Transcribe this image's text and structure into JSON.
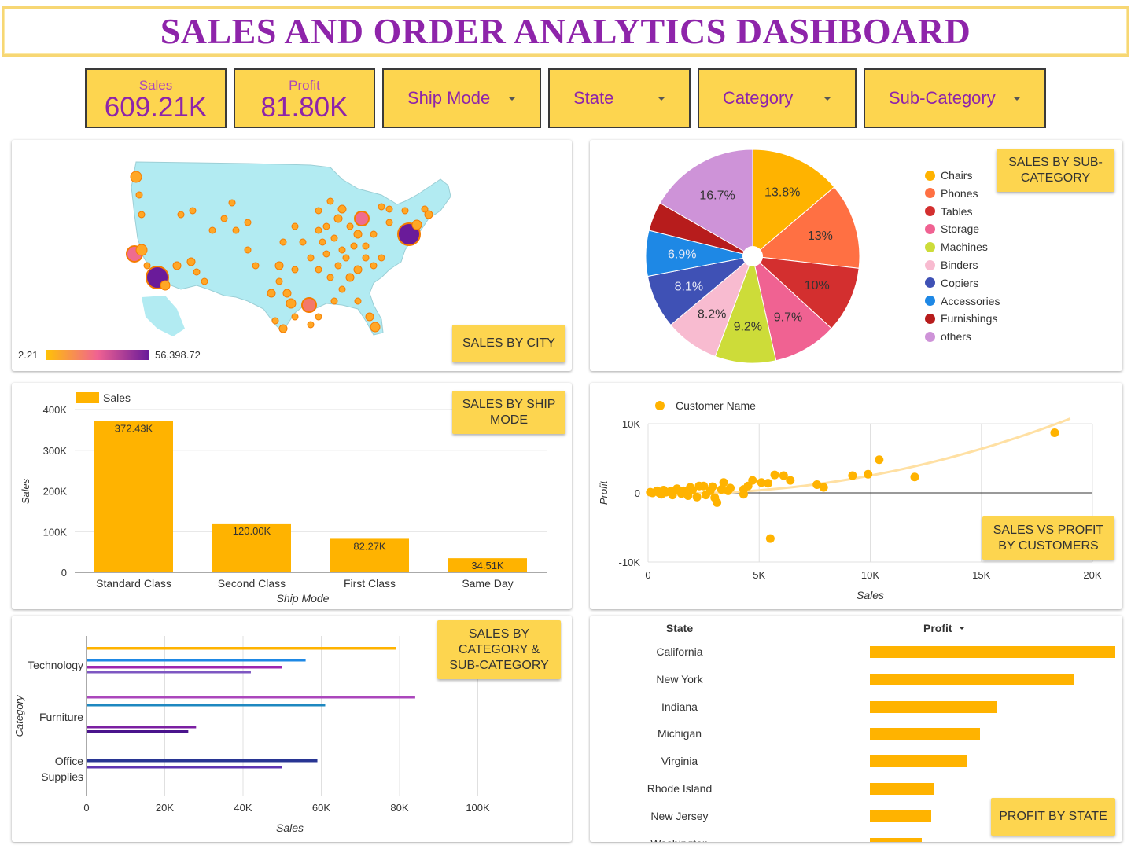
{
  "title": "SALES AND ORDER ANALYTICS DASHBOARD",
  "kpis": {
    "sales": {
      "label": "Sales",
      "value": "609.21K"
    },
    "profit": {
      "label": "Profit",
      "value": "81.80K"
    }
  },
  "filters": {
    "ship_mode": "Ship Mode",
    "state": "State",
    "category": "Category",
    "sub_category": "Sub-Category"
  },
  "colors": {
    "accent": "#fdd54f",
    "title": "#8e24aa",
    "bar": "#ffb300"
  },
  "map_panel": {
    "tag": "SALES BY CITY",
    "scale_min": "2.21",
    "scale_max": "56,398.72"
  },
  "pie_panel": {
    "tag": "SALES BY SUB-CATEGORY",
    "chart_data": {
      "type": "pie",
      "slices": [
        {
          "name": "Chairs",
          "label": "13.8%",
          "value": 13.8,
          "color": "#ffb300"
        },
        {
          "name": "Phones",
          "label": "13%",
          "value": 13.0,
          "color": "#ff7043"
        },
        {
          "name": "Tables",
          "label": "10%",
          "value": 10.0,
          "color": "#d32f2f"
        },
        {
          "name": "Storage",
          "label": "9.7%",
          "value": 9.7,
          "color": "#f06292"
        },
        {
          "name": "Machines",
          "label": "9.2%",
          "value": 9.2,
          "color": "#cddc39"
        },
        {
          "name": "Binders",
          "label": "8.2%",
          "value": 8.2,
          "color": "#f8bbd0"
        },
        {
          "name": "Copiers",
          "label": "8.1%",
          "value": 8.1,
          "color": "#3f51b5"
        },
        {
          "name": "Accessories",
          "label": "6.9%",
          "value": 6.9,
          "color": "#1e88e5"
        },
        {
          "name": "Furnishings",
          "label": "",
          "value": 4.4,
          "color": "#b71c1c"
        },
        {
          "name": "others",
          "label": "16.7%",
          "value": 16.7,
          "color": "#ce93d8"
        }
      ]
    }
  },
  "ship_panel": {
    "tag": "SALES BY SHIP MODE",
    "chart_data": {
      "type": "bar",
      "legend": "Sales",
      "xlabel": "Ship Mode",
      "ylabel": "Sales",
      "categories": [
        "Standard Class",
        "Second Class",
        "First Class",
        "Same Day"
      ],
      "values": [
        372430,
        120000,
        82270,
        34510
      ],
      "value_labels": [
        "372.43K",
        "120.00K",
        "82.27K",
        "34.51K"
      ],
      "yticks": [
        "0",
        "100K",
        "200K",
        "300K",
        "400K"
      ],
      "ylim": [
        0,
        400000
      ]
    }
  },
  "scatter_panel": {
    "tag": "SALES VS PROFIT BY CUSTOMERS",
    "chart_data": {
      "type": "scatter",
      "legend": "Customer Name",
      "xlabel": "Sales",
      "ylabel": "Profit",
      "xticks": [
        "0",
        "5K",
        "10K",
        "15K",
        "20K"
      ],
      "yticks": [
        "-10K",
        "0",
        "10K"
      ],
      "xlim": [
        0,
        20000
      ],
      "ylim": [
        -10000,
        10000
      ],
      "trendline": true,
      "points": [
        [
          18300,
          8700
        ],
        [
          10400,
          4800
        ],
        [
          9900,
          2700
        ],
        [
          12000,
          2300
        ],
        [
          9200,
          2500
        ],
        [
          7900,
          800
        ],
        [
          7600,
          1200
        ],
        [
          6400,
          1800
        ],
        [
          5700,
          2600
        ],
        [
          5400,
          1400
        ],
        [
          5100,
          1500
        ],
        [
          4700,
          1800
        ],
        [
          6100,
          2500
        ],
        [
          5500,
          -6600
        ],
        [
          4300,
          -200
        ],
        [
          4300,
          500
        ],
        [
          3300,
          500
        ],
        [
          3100,
          -1400
        ],
        [
          3400,
          1500
        ],
        [
          2800,
          300
        ],
        [
          2500,
          1000
        ],
        [
          2200,
          -600
        ],
        [
          1900,
          800
        ],
        [
          1600,
          300
        ],
        [
          1300,
          600
        ],
        [
          1000,
          200
        ],
        [
          800,
          100
        ],
        [
          600,
          -200
        ],
        [
          400,
          300
        ],
        [
          200,
          0
        ],
        [
          100,
          100
        ],
        [
          3700,
          700
        ],
        [
          2900,
          900
        ],
        [
          2000,
          400
        ],
        [
          1100,
          -300
        ],
        [
          3600,
          300
        ],
        [
          4500,
          1000
        ],
        [
          2600,
          -300
        ],
        [
          1500,
          -100
        ],
        [
          700,
          400
        ],
        [
          3000,
          -700
        ],
        [
          2300,
          1000
        ],
        [
          1800,
          -400
        ],
        [
          1200,
          300
        ],
        [
          500,
          0
        ]
      ]
    }
  },
  "category_panel": {
    "tag": "SALES BY CATEGORY & SUB-CATEGORY",
    "chart_data": {
      "type": "bar",
      "orientation": "horizontal",
      "xlabel": "Sales",
      "ylabel": "Category",
      "categories": [
        "Technology",
        "Furniture",
        "Office Supplies"
      ],
      "xticks": [
        "0",
        "20K",
        "40K",
        "60K",
        "80K",
        "100K"
      ],
      "xlim": [
        0,
        120000
      ],
      "groups": [
        {
          "category": "Technology",
          "values": [
            79000,
            56000,
            50000,
            42000
          ],
          "colors": [
            "#ffb300",
            "#1e88e5",
            "#9c27b0",
            "#7e57c2"
          ]
        },
        {
          "category": "Furniture",
          "values": [
            84000,
            61000,
            28000,
            26000
          ],
          "colors": [
            "#ab47bc",
            "#1e88c0",
            "#7b1fa2",
            "#4a148c"
          ]
        },
        {
          "category": "Office Supplies",
          "values": [
            59000,
            50000
          ],
          "colors": [
            "#283593",
            "#5e35b1"
          ]
        }
      ]
    }
  },
  "state_panel": {
    "tag": "PROFIT BY STATE",
    "col_state": "State",
    "col_profit": "Profit",
    "chart_data": {
      "type": "table",
      "rows": [
        {
          "state": "California",
          "profit": 1.0
        },
        {
          "state": "New York",
          "profit": 0.83
        },
        {
          "state": "Indiana",
          "profit": 0.52
        },
        {
          "state": "Michigan",
          "profit": 0.45
        },
        {
          "state": "Virginia",
          "profit": 0.395
        },
        {
          "state": "Rhode Island",
          "profit": 0.26
        },
        {
          "state": "New Jersey",
          "profit": 0.25
        },
        {
          "state": "Washington",
          "profit": 0.21
        }
      ]
    }
  }
}
